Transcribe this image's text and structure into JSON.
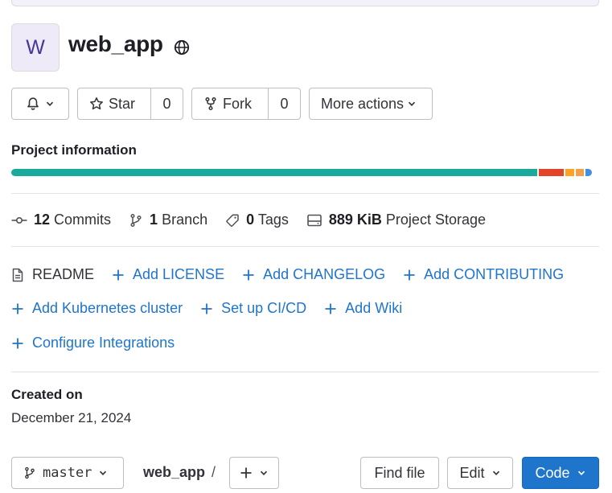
{
  "project": {
    "avatar_letter": "W",
    "name": "web_app"
  },
  "actions": {
    "star_label": "Star",
    "star_count": "0",
    "fork_label": "Fork",
    "fork_count": "0",
    "more_label": "More actions"
  },
  "project_info": {
    "title": "Project information",
    "languages": [
      {
        "color": "#1aaa9b",
        "fraction": 0.905
      },
      {
        "color": "#e24329",
        "fraction": 0.043
      },
      {
        "color": "#fca326",
        "fraction": 0.014
      },
      {
        "color": "#f0a14a",
        "fraction": 0.014
      },
      {
        "color": "#428fdc",
        "fraction": 0.012
      }
    ]
  },
  "stats": {
    "commits_count": "12",
    "commits_label": "Commits",
    "branch_count": "1",
    "branch_label": "Branch",
    "tags_count": "0",
    "tags_label": "Tags",
    "storage_value": "889 KiB",
    "storage_label": "Project Storage"
  },
  "quick_links": {
    "readme": "README",
    "add_license": "Add LICENSE",
    "add_changelog": "Add CHANGELOG",
    "add_contributing": "Add CONTRIBUTING",
    "add_kubernetes": "Add Kubernetes cluster",
    "setup_cicd": "Set up CI/CD",
    "add_wiki": "Add Wiki",
    "configure_integrations": "Configure Integrations"
  },
  "created": {
    "label": "Created on",
    "date": "December 21, 2024"
  },
  "repo_bar": {
    "branch": "master",
    "breadcrumb": "web_app",
    "separator": "/",
    "find_file": "Find file",
    "edit": "Edit",
    "code": "Code"
  },
  "colors": {
    "link": "#1f75cb",
    "primary_button": "#1f75cb",
    "avatar_bg": "#eeeaf8",
    "avatar_text": "#45369c"
  }
}
